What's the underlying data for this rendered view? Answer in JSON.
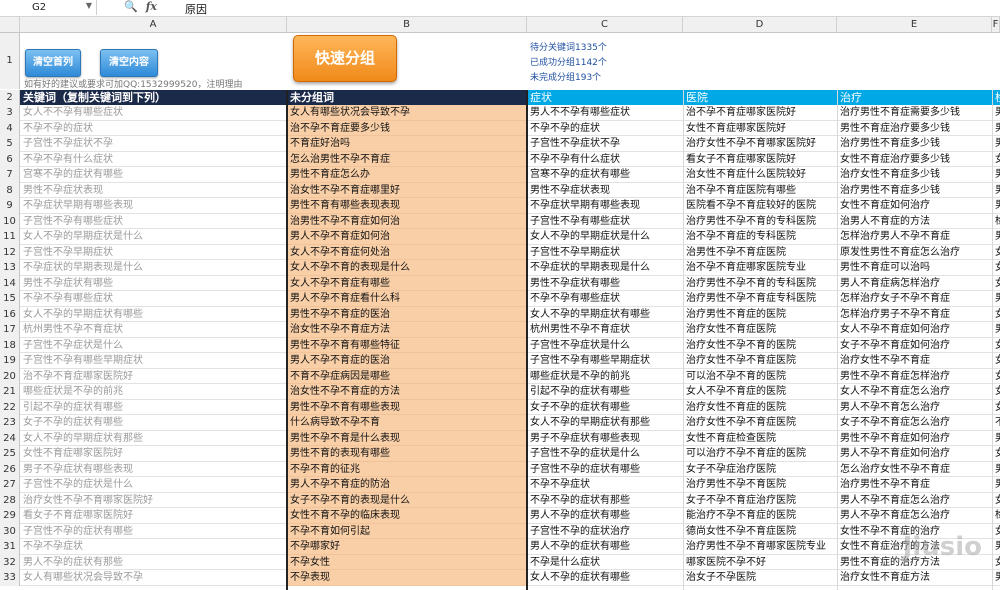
{
  "formula_bar": {
    "cell_ref": "G2",
    "fx": "fx",
    "value": "原因"
  },
  "columns": [
    "A",
    "B",
    "C",
    "D",
    "E",
    "F"
  ],
  "row1": {
    "btn_clear_first": "清空首列",
    "btn_clear_content": "清空内容",
    "btn_group": "快速分组",
    "contact_text": "如有好的建议或要求可加QQ:1532999520，注明理由",
    "stats": [
      "待分关键词1335个",
      "已成功分组1142个",
      "未完成分组193个"
    ]
  },
  "header_row": {
    "a": "关键词（复制关键词到下列）",
    "b": "未分组词",
    "c": "症状",
    "d": "医院",
    "e": "治疗",
    "f": "检"
  },
  "rows": [
    {
      "n": "3",
      "a": "女人不不孕有哪些症状",
      "b": "女人有哪些状况会导致不孕",
      "c": "男人不不孕有哪些症状",
      "d": "治不孕不育症哪家医院好",
      "e": "治疗男性不育症需要多少钱",
      "f": "男"
    },
    {
      "n": "4",
      "a": "不孕不孕的症状",
      "b": "治不孕不育症要多少钱",
      "c": "不孕不孕的症状",
      "d": "女性不育症哪家医院好",
      "e": "男性不育症治疗要多少钱",
      "f": "男"
    },
    {
      "n": "5",
      "a": "子宫性不孕症状不孕",
      "b": "不育症好治吗",
      "c": "子宫性不孕症状不孕",
      "d": "治疗女性不孕不育哪家医院好",
      "e": "治疗男性不育症多少钱",
      "f": "男"
    },
    {
      "n": "6",
      "a": "不孕不孕有什么症状",
      "b": "怎么治男性不孕不育症",
      "c": "不孕不孕有什么症状",
      "d": "看女子不育症哪家医院好",
      "e": "女性不育症治疗要多少钱",
      "f": "女"
    },
    {
      "n": "7",
      "a": "宫寒不孕的症状有哪些",
      "b": "男性不育症怎么办",
      "c": "宫寒不孕的症状有哪些",
      "d": "治女性不育症什么医院较好",
      "e": "治疗女性不育症多少钱",
      "f": "男"
    },
    {
      "n": "8",
      "a": "男性不孕症状表现",
      "b": "治女性不孕不育症哪里好",
      "c": "男性不孕症状表现",
      "d": "治不孕不育症医院有哪些",
      "e": "治疗男性不育症多少钱",
      "f": "男"
    },
    {
      "n": "9",
      "a": "不孕症状早期有哪些表现",
      "b": "男性不育有哪些表现表现",
      "c": "不孕症状早期有哪些表现",
      "d": "医院看不孕不育症较好的医院",
      "e": "女性不育症如何治疗",
      "f": "男"
    },
    {
      "n": "10",
      "a": "子宫性不孕有哪些症状",
      "b": "治男性不孕不育症如何治",
      "c": "子宫性不孕有哪些症状",
      "d": "治疗男性不孕不育的专科医院",
      "e": "治男人不育症的方法",
      "f": "检"
    },
    {
      "n": "11",
      "a": "女人不孕的早期症状是什么",
      "b": "男人不孕不育症如何治",
      "c": "女人不孕的早期症状是什么",
      "d": "治不孕不育症的专科医院",
      "e": "怎样治疗男人不孕不育症",
      "f": "男"
    },
    {
      "n": "12",
      "a": "子宫性不孕早期症状",
      "b": "女人不孕不育症何处治",
      "c": "子宫性不孕早期症状",
      "d": "治男性不孕不育症医院",
      "e": "原发性男性不育症怎么治疗",
      "f": "女"
    },
    {
      "n": "13",
      "a": "不孕症状的早期表现是什么",
      "b": "女人不孕不育的表现是什么",
      "c": "不孕症状的早期表现是什么",
      "d": "治不孕不育症哪家医院专业",
      "e": "男性不育症可以治吗",
      "f": "女"
    },
    {
      "n": "14",
      "a": "男性不孕症状有哪些",
      "b": "女人不孕不育症有哪些",
      "c": "男性不孕症状有哪些",
      "d": "治疗男性不孕不育的专科医院",
      "e": "男人不育症病怎样治疗",
      "f": "女"
    },
    {
      "n": "15",
      "a": "不孕不孕有哪些症状",
      "b": "男人不孕不育症看什么科",
      "c": "不孕不孕有哪些症状",
      "d": "治疗男性不孕不育症专科医院",
      "e": "怎样治疗女子不孕不育症",
      "f": "男"
    },
    {
      "n": "16",
      "a": "女人不孕的早期症状有哪些",
      "b": "男性不孕不育症的医治",
      "c": "女人不孕的早期症状有哪些",
      "d": "治疗男性不育症的医院",
      "e": "怎样治疗男子不孕不育症",
      "f": "女"
    },
    {
      "n": "17",
      "a": "杭州男性不孕不育症状",
      "b": "治女性不孕不育症方法",
      "c": "杭州男性不孕不育症状",
      "d": "治疗女性不育症医院",
      "e": "女人不孕不育症如何治疗",
      "f": "男"
    },
    {
      "n": "18",
      "a": "子宫性不孕症状是什么",
      "b": "男性不孕不育有哪些特征",
      "c": "子宫性不孕症状是什么",
      "d": "治疗女性不孕不育的医院",
      "e": "女子不孕不育症如何治疗",
      "f": "女"
    },
    {
      "n": "19",
      "a": "子宫性不孕有哪些早期症状",
      "b": "男人不孕不育症的医治",
      "c": "子宫性不孕有哪些早期症状",
      "d": "治疗女性不孕不育症医院",
      "e": "治疗女性不孕不育症",
      "f": "女"
    },
    {
      "n": "20",
      "a": "治不孕不育症哪家医院好",
      "b": "不育不孕症病因是哪些",
      "c": "哪些症状是不孕的前兆",
      "d": "可以治不孕不育的医院",
      "e": "男性不孕不育症怎样治疗",
      "f": "女"
    },
    {
      "n": "21",
      "a": "哪些症状是不孕的前兆",
      "b": "治女性不孕不育症的方法",
      "c": "引起不孕的症状有哪些",
      "d": "女人不孕不育症的医院",
      "e": "女人不孕不育症怎么治疗",
      "f": "女"
    },
    {
      "n": "22",
      "a": "引起不孕的症状有哪些",
      "b": "男性不孕不育有哪些表现",
      "c": "女子不孕的症状有哪些",
      "d": "治疗女性不育症的医院",
      "e": "男人不孕不育怎么治疗",
      "f": "女"
    },
    {
      "n": "23",
      "a": "女子不孕的症状有哪些",
      "b": "什么病导致不孕不育",
      "c": "女人不孕的早期症状有那些",
      "d": "治疗女性不孕不育症医院",
      "e": "女子不孕不育症怎么治疗",
      "f": "不"
    },
    {
      "n": "24",
      "a": "女人不孕的早期症状有那些",
      "b": "男性不孕不育是什么表现",
      "c": "男子不孕症状有哪些表现",
      "d": "女性不育症检查医院",
      "e": "男性不孕不育症如何治疗",
      "f": "男"
    },
    {
      "n": "25",
      "a": "女性不育症哪家医院好",
      "b": "男性不育的表现有哪些",
      "c": "子宫性不孕的症状是什么",
      "d": "可以治疗不孕不育症的医院",
      "e": "男人不孕不育症如何治疗",
      "f": "女"
    },
    {
      "n": "26",
      "a": "男子不孕症状有哪些表现",
      "b": "不孕不育的征兆",
      "c": "子宫性不孕的症状有哪些",
      "d": "女子不孕症治疗医院",
      "e": "怎么治疗女性不孕不育症",
      "f": "男"
    },
    {
      "n": "27",
      "a": "子宫性不孕的症状是什么",
      "b": "男人不孕不育症的防治",
      "c": "不孕不孕症状",
      "d": "治疗男性不孕不育医院",
      "e": "治疗男性不孕不育症",
      "f": "男"
    },
    {
      "n": "28",
      "a": "治疗女性不孕不育哪家医院好",
      "b": "女子不孕不育的表现是什么",
      "c": "不孕不孕的症状有那些",
      "d": "女子不孕不育症治疗医院",
      "e": "男人不孕不育症怎么治疗",
      "f": "女"
    },
    {
      "n": "29",
      "a": "看女子不育症哪家医院好",
      "b": "女性不育不孕的临床表现",
      "c": "男人不孕的症状有哪些",
      "d": "能治疗不孕不育症的医院",
      "e": "男人不孕不育症怎么治疗",
      "f": "检"
    },
    {
      "n": "30",
      "a": "子宫性不孕的症状有哪些",
      "b": "不孕不育如何引起",
      "c": "子宫性不孕的症状治疗",
      "d": "德尚女性不孕不育症医院",
      "e": "女性不孕不育症的治疗",
      "f": "女"
    },
    {
      "n": "31",
      "a": "不孕不孕症状",
      "b": "不孕哪家好",
      "c": "男人不孕的症状有哪些",
      "d": "治疗男性不孕不育哪家医院专业",
      "e": "女性不育症治疗的方法",
      "f": "男"
    },
    {
      "n": "32",
      "a": "男人不孕的症状有那些",
      "b": "不孕女性",
      "c": "不孕是什么症状",
      "d": "哪家医院不孕不好",
      "e": "男性不育症的治疗方法",
      "f": "女"
    },
    {
      "n": "33",
      "a": "女人有哪些状况会导致不孕",
      "b": "不孕表现",
      "c": "女人不孕的症状有哪些",
      "d": "治女子不孕医院",
      "e": "治疗女性不育症方法",
      "f": "男"
    }
  ],
  "watermark": "jiusio",
  "colors": {
    "header_blue": "#00a8e6",
    "header_dark": "#1c2a4a",
    "orange_cell": "#f9cfa8",
    "stats_text": "#1f4fa0"
  }
}
